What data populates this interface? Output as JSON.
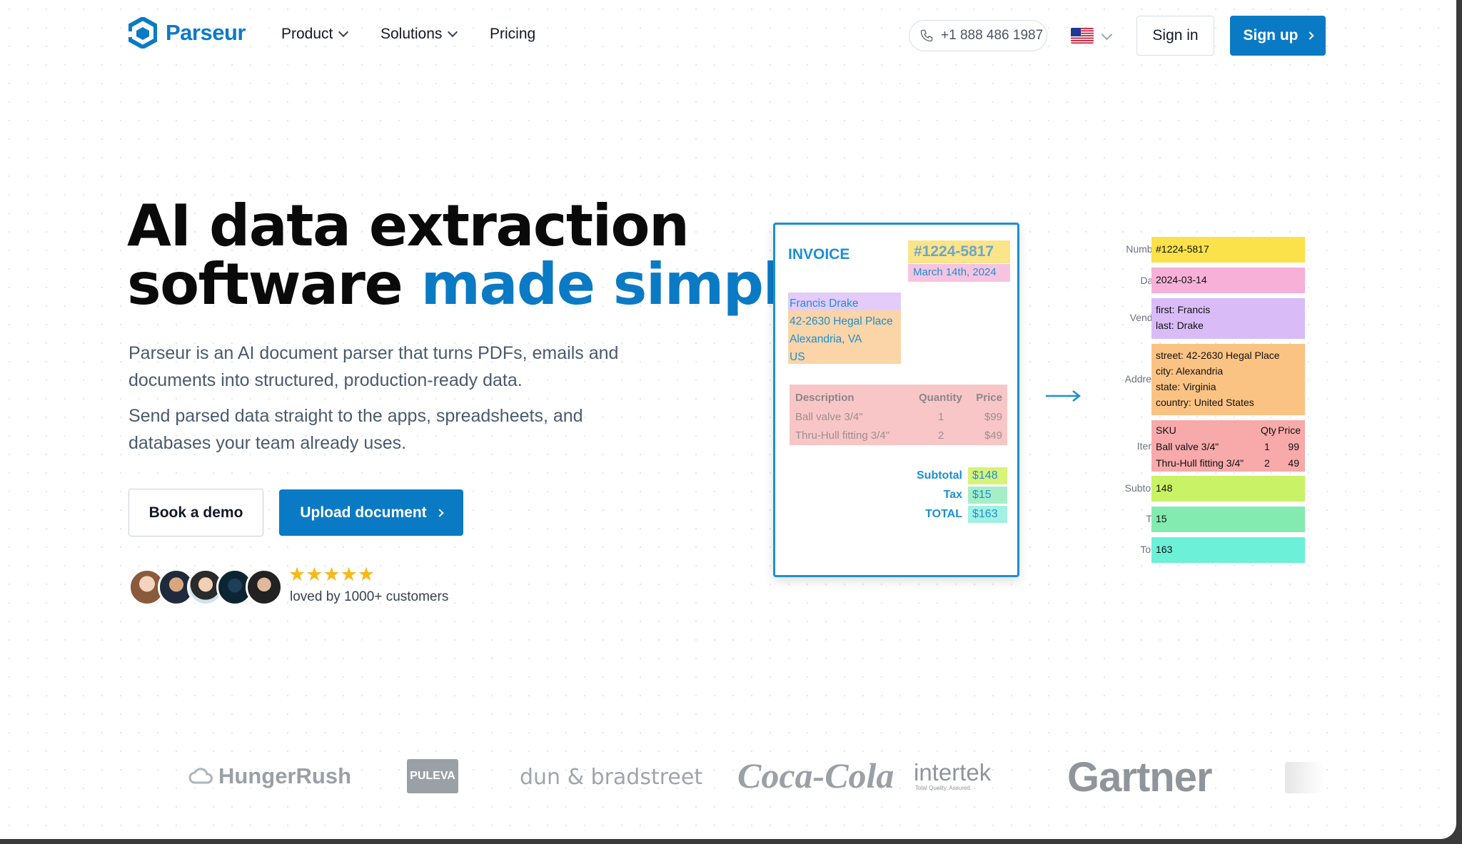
{
  "nav": {
    "brand": "Parseur",
    "links": [
      "Product",
      "Solutions",
      "Pricing"
    ],
    "phone": "+1 888 486 1987",
    "sign_in": "Sign in",
    "sign_up": "Sign up"
  },
  "hero": {
    "title_line1": "AI data extraction",
    "title_line2_a": "software ",
    "title_line2_b": "made simple",
    "para1": "Parseur is an AI document parser that turns PDFs, emails and documents into structured, production-ready data.",
    "para2": "Send parsed data straight to the apps, spreadsheets, and databases your team already uses.",
    "btn_demo": "Book a demo",
    "btn_upload": "Upload document",
    "stars": "★★★★★",
    "loved": "loved by 1000+ customers"
  },
  "invoice": {
    "title": "INVOICE",
    "number": "#1224-5817",
    "date": "March 14th, 2024",
    "address": [
      "Francis Drake",
      "42-2630 Hegal Place",
      "Alexandria, VA",
      "US"
    ],
    "headers": [
      "Description",
      "Quantity",
      "Price"
    ],
    "rows": [
      {
        "desc": "Ball valve 3/4\"",
        "qty": "1",
        "price": "$99"
      },
      {
        "desc": "Thru-Hull fitting 3/4\"",
        "qty": "2",
        "price": "$49"
      }
    ],
    "subtotal_label": "Subtotal",
    "subtotal": "$148",
    "tax_label": "Tax",
    "tax": "$15",
    "total_label": "TOTAL",
    "total": "$163"
  },
  "fields": {
    "number": {
      "label": "Number",
      "value": "#1224-5817",
      "color": "#fbe14a"
    },
    "date": {
      "label": "Date",
      "value": "2024-03-14",
      "color": "#f7b0d8"
    },
    "vendor": {
      "label": "Vendor",
      "line1": "first: Francis",
      "line2": "last: Drake",
      "color": "#d9bcf7"
    },
    "address": {
      "label": "Address",
      "line1": "street: 42-2630 Hegal Place",
      "line2": "city: Alexandria",
      "line3": "state: Virginia",
      "line4": "country: United States",
      "color": "#fbc383"
    },
    "items": {
      "label": "Items",
      "h_sku": "SKU",
      "h_qty": "Qty",
      "h_price": "Price",
      "r1_sku": "Ball valve 3/4\"",
      "r1_qty": "1",
      "r1_price": "99",
      "r2_sku": "Thru-Hull fitting 3/4\"",
      "r2_qty": "2",
      "r2_price": "49",
      "color": "#f8a9a9"
    },
    "subtotal": {
      "label": "Subtotal",
      "value": "148",
      "color": "#c9f266"
    },
    "tax": {
      "label": "Tax",
      "value": "15",
      "color": "#84ebb0"
    },
    "total": {
      "label": "Total",
      "value": "163",
      "color": "#6cf0d8"
    }
  },
  "logos": [
    "HungerRush",
    "PULEVA",
    "dun & bradstreet",
    "Coca-Cola",
    "intertek",
    "Total Quality. Assured.",
    "Gartner"
  ],
  "colors": {
    "accent": "#0b7ac4",
    "invoice_border": "#1d8fd0",
    "star": "#f6b91a"
  }
}
